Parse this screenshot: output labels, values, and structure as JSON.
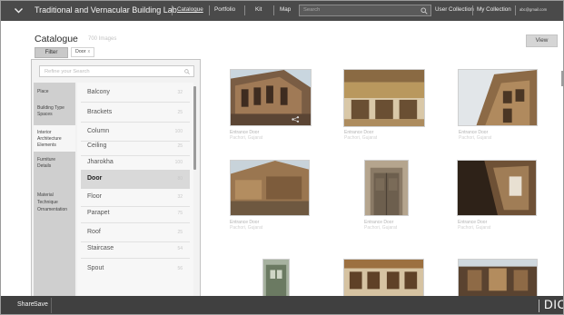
{
  "app": {
    "title": "Traditional and Vernacular Building Lab",
    "nav": [
      "Catalogue",
      "Portfolio",
      "Kit",
      "Map"
    ],
    "search_placeholder": "Search",
    "links": [
      "User Collection",
      "My Collection"
    ],
    "email": "abc@gmail.com"
  },
  "catalogue": {
    "title": "Catalogue",
    "count": "700 Images",
    "filter_label": "Filter",
    "chip_label": "Door",
    "chip_close": "x",
    "view_label": "View"
  },
  "filter_panel": {
    "refine_placeholder": "Refine your Search",
    "categories": [
      {
        "lines": [
          "Place"
        ],
        "active": false
      },
      {
        "lines": [
          "Building Type",
          "Spaces"
        ],
        "active": false
      },
      {
        "lines": [
          "Interior",
          "Architecture",
          "Elements"
        ],
        "active": true
      },
      {
        "lines": [
          "Furniture",
          "Details"
        ],
        "active": false
      },
      {
        "lines": [
          "Material",
          "Technique",
          "Ornamentation"
        ],
        "active": false
      }
    ],
    "subcategories": [
      {
        "name": "Balcony",
        "count": "32"
      },
      {
        "name": "Brackets",
        "count": "25"
      },
      {
        "name": "Column",
        "count": "100"
      },
      {
        "name": "Ceiling",
        "count": "25"
      },
      {
        "name": "Jharokha",
        "count": "100"
      },
      {
        "name": "Door",
        "count": "80",
        "active": true
      },
      {
        "name": "Floor",
        "count": "32"
      },
      {
        "name": "Parapet",
        "count": "75"
      },
      {
        "name": "Roof",
        "count": "25"
      },
      {
        "name": "Staircase",
        "count": "54"
      },
      {
        "name": "Spout",
        "count": "56"
      }
    ]
  },
  "images": [
    {
      "title": "Entrance Door",
      "place": "Pachori, Gujarat"
    },
    {
      "title": "Entrance Door",
      "place": "Pachori, Gujarat"
    },
    {
      "title": "Entrance Door",
      "place": "Pachori, Gujarat"
    },
    {
      "title": "Entrance Door",
      "place": "Pachori, Gujarat"
    },
    {
      "title": "Entrance Door",
      "place": "Pachori, Gujarat"
    },
    {
      "title": "Entrance Door",
      "place": "Pachori, Gujarat"
    },
    {
      "title": "",
      "place": ""
    },
    {
      "title": "",
      "place": ""
    },
    {
      "title": "",
      "place": ""
    }
  ],
  "bottom": {
    "share_label": "Share",
    "save_label": "Save",
    "brand": "DICRC"
  },
  "icons": {
    "menu": "chevron-down-icon",
    "search": "search-icon",
    "share": "share-icon"
  },
  "colors": {
    "topbar": "#4a4a4a",
    "bottombar": "#404040",
    "panel": "#f2f2f2",
    "category_column": "#cfcfcf",
    "active_row": "#d9d9d9"
  }
}
